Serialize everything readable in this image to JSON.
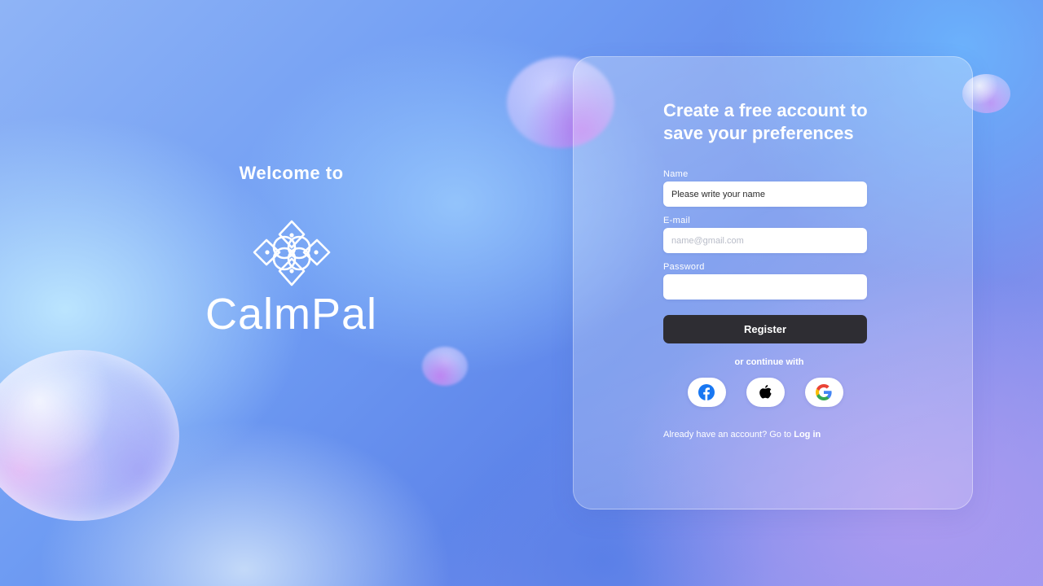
{
  "brand": {
    "welcome": "Welcome to",
    "logo_icon": "lotus-flower-icon",
    "app_name": "CalmPal"
  },
  "form": {
    "title": "Create a free account to save your preferences",
    "name_label": "Name",
    "name_value": "Please write your name",
    "email_label": "E-mail",
    "email_placeholder": "name@gmail.com",
    "password_label": "Password",
    "password_value": "",
    "register_label": "Register",
    "continue_text": "or continue with",
    "social": [
      {
        "icon": "facebook-icon",
        "color": "#1877F2"
      },
      {
        "icon": "apple-icon",
        "color": "#000000"
      },
      {
        "icon": "google-icon",
        "color": "#4285F4"
      }
    ],
    "login_prompt": "Already have an account? Go to",
    "login_link": "Log in"
  },
  "colors": {
    "button_dark": "#2e2d33",
    "text_light": "#ffffff"
  }
}
